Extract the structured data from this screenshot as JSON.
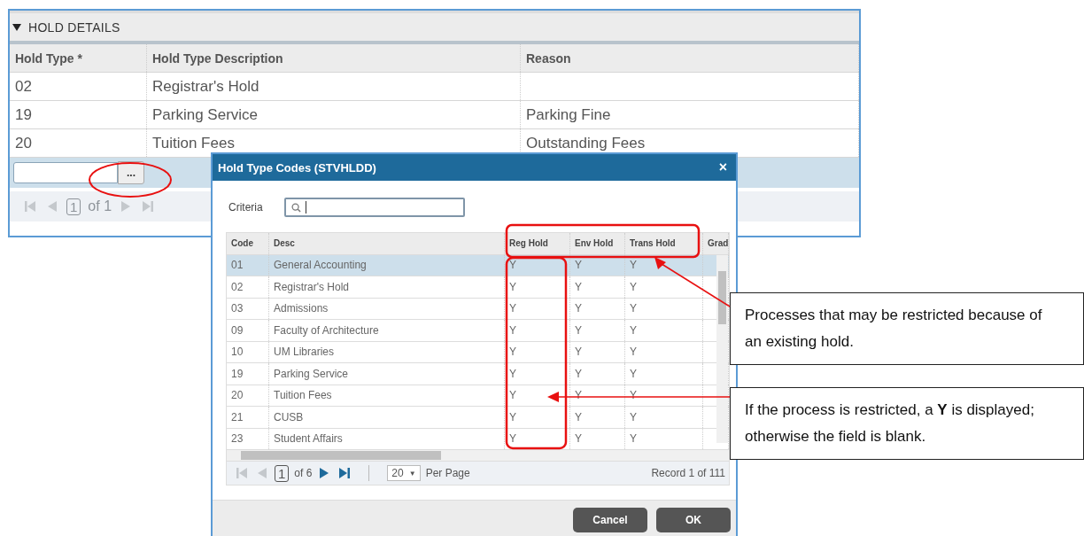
{
  "hold_details": {
    "title": "HOLD DETAILS",
    "expanded": true,
    "columns": [
      "Hold Type *",
      "Hold Type Description",
      "Reason"
    ],
    "rows": [
      {
        "hold_type": "02",
        "description": "Registrar's Hold",
        "reason": ""
      },
      {
        "hold_type": "19",
        "description": "Parking Service",
        "reason": "Parking Fine"
      },
      {
        "hold_type": "20",
        "description": "Tuition Fees",
        "reason": "Outstanding Fees"
      }
    ],
    "new_row": {
      "lookup_button": "..."
    },
    "pager": {
      "page": "1",
      "of": "of 1",
      "nav": [
        {
          "kind": "first",
          "disabled": true
        },
        {
          "kind": "prev",
          "disabled": true
        },
        {
          "kind": "next",
          "disabled": true
        },
        {
          "kind": "last",
          "disabled": true
        }
      ]
    }
  },
  "dialog": {
    "title": "Hold Type Codes (STVHLDD)",
    "close": "×",
    "criteria_label": "Criteria",
    "columns": [
      "Code",
      "Desc",
      "Reg Hold",
      "Env Hold",
      "Trans Hold",
      "Grad"
    ],
    "rows": [
      {
        "code": "01",
        "desc": "General Accounting",
        "reg_hold": "Y",
        "env_hold": "Y",
        "trans_hold": "Y",
        "selected": true
      },
      {
        "code": "02",
        "desc": "Registrar's Hold",
        "reg_hold": "Y",
        "env_hold": "Y",
        "trans_hold": "Y",
        "selected": false
      },
      {
        "code": "03",
        "desc": "Admissions",
        "reg_hold": "Y",
        "env_hold": "Y",
        "trans_hold": "Y",
        "selected": false
      },
      {
        "code": "09",
        "desc": "Faculty of Architecture",
        "reg_hold": "Y",
        "env_hold": "Y",
        "trans_hold": "Y",
        "selected": false
      },
      {
        "code": "10",
        "desc": "UM Libraries",
        "reg_hold": "Y",
        "env_hold": "Y",
        "trans_hold": "Y",
        "selected": false
      },
      {
        "code": "19",
        "desc": "Parking Service",
        "reg_hold": "Y",
        "env_hold": "Y",
        "trans_hold": "Y",
        "selected": false
      },
      {
        "code": "20",
        "desc": "Tuition Fees",
        "reg_hold": "Y",
        "env_hold": "Y",
        "trans_hold": "Y",
        "selected": false
      },
      {
        "code": "21",
        "desc": "CUSB",
        "reg_hold": "Y",
        "env_hold": "Y",
        "trans_hold": "Y",
        "selected": false
      },
      {
        "code": "23",
        "desc": "Student Affairs",
        "reg_hold": "Y",
        "env_hold": "Y",
        "trans_hold": "Y",
        "selected": false
      }
    ],
    "pager": {
      "page": "1",
      "of": "of 6",
      "nav": [
        {
          "kind": "first",
          "disabled": true
        },
        {
          "kind": "prev",
          "disabled": true
        },
        {
          "kind": "next",
          "disabled": false
        },
        {
          "kind": "last",
          "disabled": false
        }
      ],
      "per_page_value": "20",
      "per_page_caret": "▼",
      "per_page_label": "Per Page",
      "record": "Record 1 of 111"
    },
    "buttons": [
      "Cancel",
      "OK"
    ]
  },
  "callouts": [
    "Processes that may be restricted because of an existing hold.",
    "If the process is restricted, a **Y** is displayed; otherwise the field is blank."
  ]
}
